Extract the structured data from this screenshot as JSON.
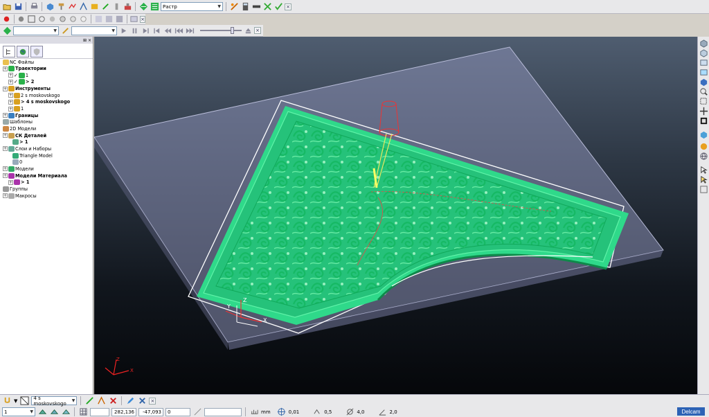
{
  "toolbar1": {
    "strategy_combo": "Растр"
  },
  "tree": {
    "items": [
      {
        "label": "NC Файлы",
        "bold": false
      },
      {
        "label": "Траектории",
        "bold": true
      },
      {
        "label": "1",
        "bold": false
      },
      {
        "label": "> 2",
        "bold": true
      },
      {
        "label": "Инструменты",
        "bold": true
      },
      {
        "label": "2 s moskovskogo",
        "bold": false
      },
      {
        "label": "> 4 s moskovskogo",
        "bold": true
      },
      {
        "label": "1",
        "bold": false
      },
      {
        "label": "Границы",
        "bold": true
      },
      {
        "label": "Шаблоны",
        "bold": false
      },
      {
        "label": "2D Модели",
        "bold": false
      },
      {
        "label": "СК Деталей",
        "bold": true
      },
      {
        "label": "> 1",
        "bold": true
      },
      {
        "label": "Слои и Наборы",
        "bold": false
      },
      {
        "label": "Triangle Model",
        "bold": false
      },
      {
        "label": "0",
        "bold": false
      },
      {
        "label": "Модели",
        "bold": false
      },
      {
        "label": "Модели Материала",
        "bold": true
      },
      {
        "label": "> 1",
        "bold": true
      },
      {
        "label": "Группы",
        "bold": false
      },
      {
        "label": "Макросы",
        "bold": false
      }
    ]
  },
  "viewport": {
    "axis_labels": {
      "x": "X",
      "y": "Y",
      "z": "Z"
    }
  },
  "status": {
    "tool_combo": "4 s moskovskogo",
    "workplane_combo": "1",
    "coord_x": "282,136",
    "coord_y": "-47,093",
    "coord_z": "0",
    "units": "mm",
    "tolerance": "0,01",
    "stepover": "0,5",
    "thickness": "4,0",
    "angle": "2,0",
    "brand": "Delcam"
  },
  "colors": {
    "model_green": "#2fd98a",
    "viewport_top": "#4f5d70",
    "brand_blue": "#2c62b5"
  }
}
